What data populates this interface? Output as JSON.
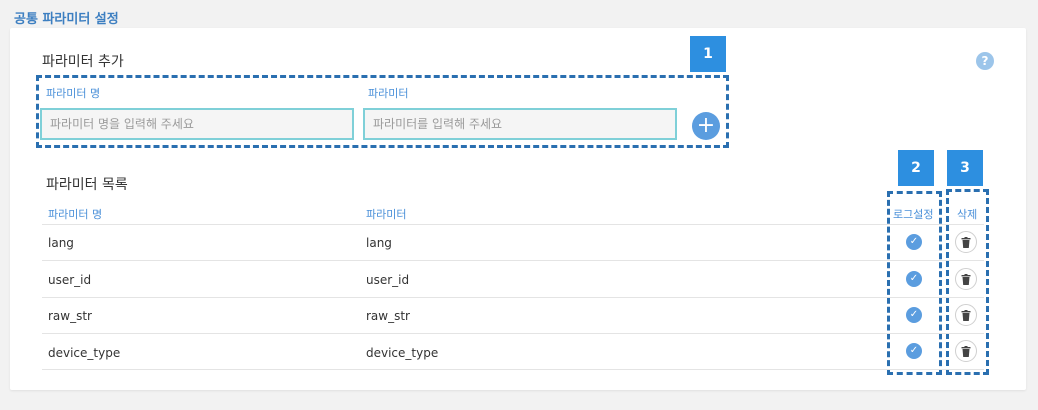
{
  "page_title": "공통 파라미터 설정",
  "add_section": {
    "title": "파라미터 추가",
    "name_label": "파라미터 명",
    "name_placeholder": "파라미터 명을 입력해 주세요",
    "value_label": "파라미터",
    "value_placeholder": "파라미터를 입력해 주세요",
    "add_icon": "plus-icon",
    "help_label": "?"
  },
  "list_section": {
    "title": "파라미터 목록",
    "columns": {
      "name": "파라미터 명",
      "value": "파라미터",
      "log": "로그설정",
      "delete": "삭제"
    },
    "rows": [
      {
        "name": "lang",
        "value": "lang",
        "log_enabled": true
      },
      {
        "name": "user_id",
        "value": "user_id",
        "log_enabled": true
      },
      {
        "name": "raw_str",
        "value": "raw_str",
        "log_enabled": true
      },
      {
        "name": "device_type",
        "value": "device_type",
        "log_enabled": true
      }
    ]
  },
  "callouts": [
    "1",
    "2",
    "3"
  ],
  "colors": {
    "accent": "#5b9ddf",
    "callout": "#2d8fe0",
    "input_border": "#7fd0d8"
  }
}
